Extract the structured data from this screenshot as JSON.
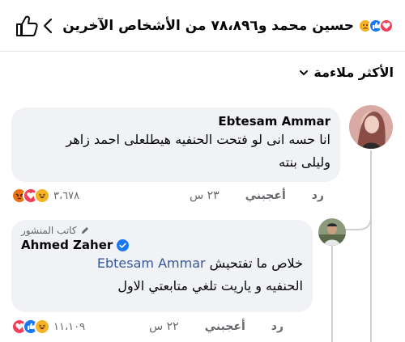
{
  "header": {
    "title": "حسين محمد و٧٨،٨٩٦ من الأشخاص الآخرين",
    "like_icon": "thumbs-up-outline-icon",
    "back_icon": "chevron-left-icon",
    "reaction_icons": [
      "heart-icon",
      "like-icon",
      "sad-icon"
    ]
  },
  "sort": {
    "label": "الأكثر ملاءمة",
    "icon": "chevron-down-icon"
  },
  "comments": [
    {
      "author": "Ebtesam Ammar",
      "line1": "انا حسه انى لو فتحت الحنفيه هيطلعلى احمد زاهر",
      "line2": "وليلى بنته",
      "time": "٢٣ س",
      "like_label": "أعجبني",
      "reply_label": "رد",
      "reaction_count": "٣،٦٧٨",
      "reaction_icons": [
        "angry-icon",
        "heart-icon",
        "haha-icon"
      ]
    },
    {
      "badge": "كاتب المنشور",
      "author": "Ahmed Zaher",
      "line1_text": "خلاص ما تفتحيش ",
      "line1_mention": "Ebtesam Ammar",
      "line2": "الحنفيه و ياريت تلغي متابعتي الاول",
      "time": "٢٢ س",
      "like_label": "أعجبني",
      "reply_label": "رد",
      "reaction_count": "١١،١٠٩",
      "reaction_icons": [
        "like-icon",
        "heart-icon",
        "haha-icon"
      ]
    }
  ],
  "colors": {
    "like_blue": "#1877f2",
    "love_red": "#f33e58",
    "haha_yellow": "#f7b125",
    "bubble": "#f0f2f5",
    "mention": "#385898"
  }
}
